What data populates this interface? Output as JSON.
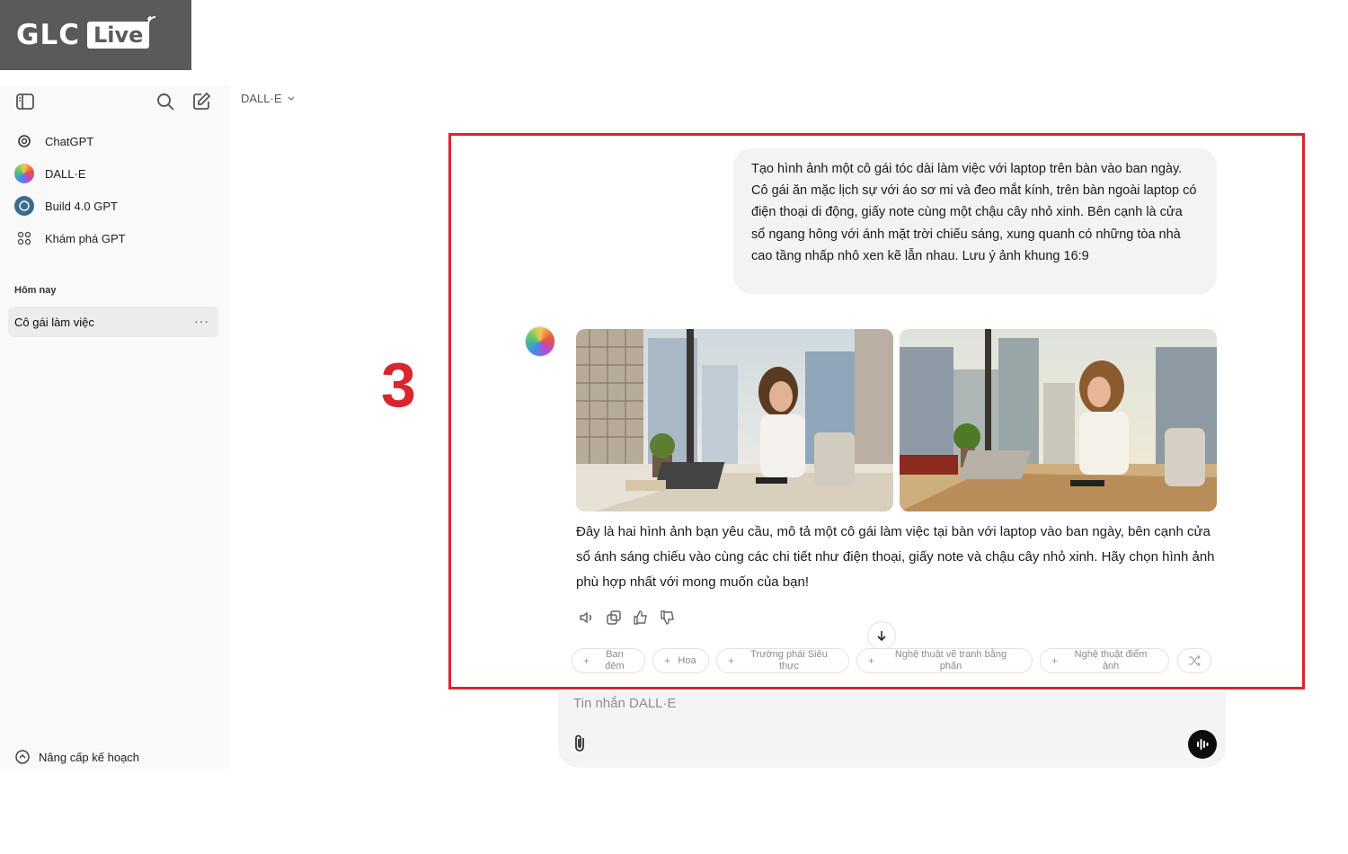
{
  "logo": {
    "brand": "GLC",
    "badge": "Live"
  },
  "sidebar": {
    "items": [
      {
        "label": "ChatGPT",
        "icon": "openai-icon"
      },
      {
        "label": "DALL·E",
        "icon": "dalle-avatar-icon"
      },
      {
        "label": "Build 4.0 GPT",
        "icon": "gpt-avatar-icon"
      },
      {
        "label": "Khám phá GPT",
        "icon": "grid-icon"
      }
    ],
    "section_title": "Hôm nay",
    "conversation": "Cô gái làm việc",
    "conversation_menu": "···",
    "upgrade": "Nâng cấp kế hoạch"
  },
  "header": {
    "model": "DALL·E"
  },
  "step_number": "3",
  "user_message": "Tạo hình ảnh một cô gái tóc dài làm việc với laptop trên bàn vào ban ngày. Cô gái ăn mặc lịch sự với áo sơ mi và đeo mắt kính, trên bàn ngoài laptop có điện thoại di động, giấy note cùng một chậu cây nhỏ xinh. Bên cạnh là cửa sổ ngang hông với ánh mặt trời chiếu sáng, xung quanh có những tòa nhà cao tầng nhấp nhô xen kẽ lẫn nhau. Lưu ý ảnh khung 16:9",
  "assistant_reply": "Đây là hai hình ảnh bạn yêu cầu, mô tả một cô gái làm việc tại bàn với laptop vào ban ngày, bên cạnh cửa sổ ánh sáng chiếu vào cùng các chi tiết như điện thoại, giấy note và chậu cây nhỏ xinh. Hãy chọn hình ảnh phù hợp nhất với mong muốn của bạn!",
  "suggestions": [
    "Ban đêm",
    "Hoa",
    "Trường phái Siêu thực",
    "Nghệ thuật vẽ tranh bằng phấn",
    "Nghệ thuật điểm ảnh"
  ],
  "composer": {
    "placeholder": "Tin nhắn DALL·E"
  },
  "colors": {
    "accent_red": "#d8262e",
    "sidebar_bg": "#f9f9f9",
    "bubble_bg": "#f3f3f3"
  }
}
